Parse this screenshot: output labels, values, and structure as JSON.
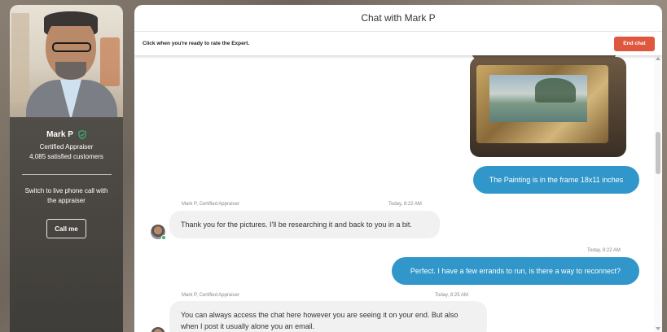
{
  "sidebar": {
    "expert_name": "Mark P",
    "title": "Certified Appraiser",
    "customers": "4,085 satisfied customers",
    "phone_text": "Switch to live phone call with the appraiser",
    "call_button": "Call me",
    "verified_icon": "shield-check-icon"
  },
  "chat": {
    "title": "Chat with Mark P",
    "rate_text": "Click when you're ready to rate the Expert.",
    "end_button": "End chat",
    "messages": [
      {
        "from": "customer",
        "type": "image",
        "alt_icon": "painting-image"
      },
      {
        "from": "customer",
        "text": "The Painting is in the frame 18x11 inches"
      },
      {
        "from": "expert",
        "author": "Mark P, Certified Appraiser",
        "time": "Today, 8:22 AM",
        "text": "Thank you for the pictures. I'll be researching it and back to you in a bit."
      },
      {
        "from": "customer",
        "time": "Today, 8:22 AM",
        "text": "Perfect. I have a few errands to run, is there a way to reconnect?"
      },
      {
        "from": "expert",
        "author": "Mark P, Certified Appraiser",
        "time": "Today, 8:25 AM",
        "text": "You can always access the chat here however you are seeing it on your end. But also when I post it usually alone you an email."
      }
    ]
  },
  "colors": {
    "accent_blue": "#3196c9",
    "end_red": "#e0573f",
    "online_green": "#3cb371"
  }
}
